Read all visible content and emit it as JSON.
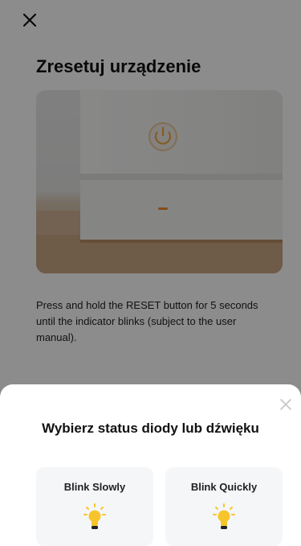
{
  "page": {
    "title": "Zresetuj urządzenie",
    "instructions": "Press and hold the RESET button for 5 seconds until the indicator blinks (subject to the user manual)."
  },
  "sheet": {
    "title": "Wybierz status diody lub dźwięku",
    "options": [
      {
        "label": "Blink Slowly",
        "icon": "lightbulb-icon"
      },
      {
        "label": "Blink Quickly",
        "icon": "lightbulb-icon"
      }
    ]
  },
  "colors": {
    "overlay": "#000000",
    "bulb": "#f7c52b",
    "indicator": "#f08a2a"
  }
}
